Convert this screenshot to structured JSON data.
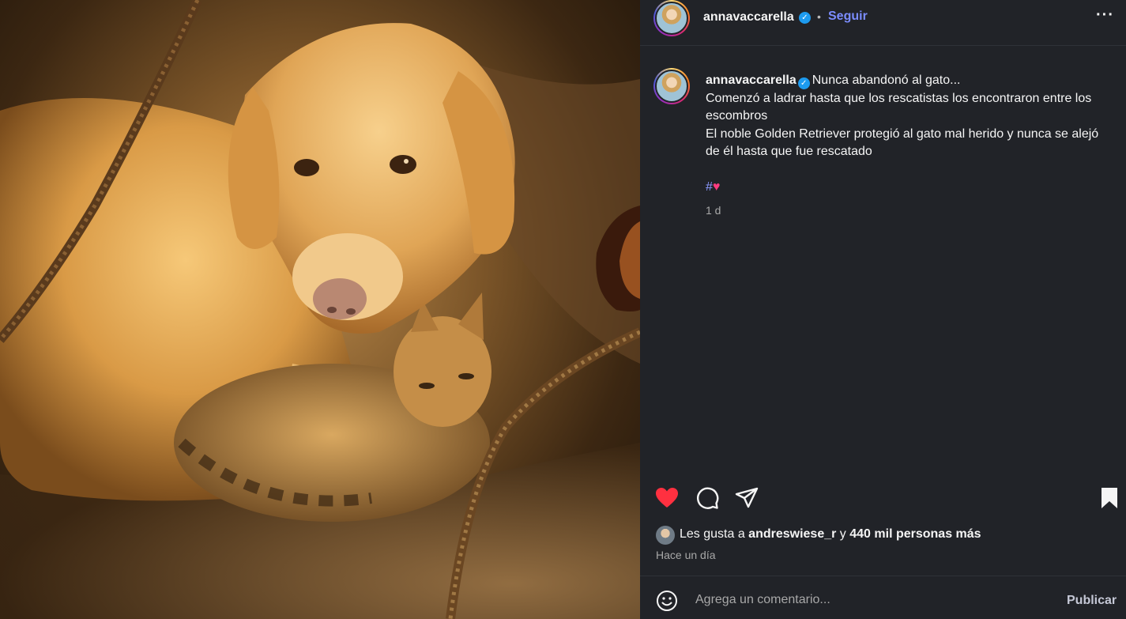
{
  "header": {
    "username": "annavaccarella",
    "verified_mark": "✓",
    "separator": "•",
    "follow_label": "Seguir",
    "more_label": "···",
    "avatar_icon": "profile-avatar"
  },
  "caption": {
    "username": "annavaccarella",
    "verified_mark": "✓",
    "line1": "Nunca abandonó al gato...",
    "line2": "Comenzó a ladrar hasta que los rescatistas los encontraron entre los escombros",
    "line3": "El noble Golden Retriever protegió al gato mal herido y nunca se alejó de él hasta que fue rescatado",
    "hashtag_symbol": "#",
    "hashtag_emoji": "♥",
    "time": "1 d"
  },
  "actions": {
    "like_icon": "heart-filled-icon",
    "comment_icon": "comment-icon",
    "share_icon": "send-icon",
    "save_icon": "bookmark-filled-icon",
    "like_color": "#ff3040"
  },
  "likes": {
    "prefix": "Les gusta a ",
    "user": "andreswiese_r",
    "middle": " y ",
    "count": "440 mil personas más",
    "time": "Hace un día"
  },
  "comment": {
    "placeholder": "Agrega un comentario...",
    "publish_label": "Publicar",
    "emoji_icon": "smiley-icon"
  },
  "colors": {
    "panel_bg": "#212328",
    "link": "#7b8cff",
    "verified": "#1d9bf0"
  }
}
